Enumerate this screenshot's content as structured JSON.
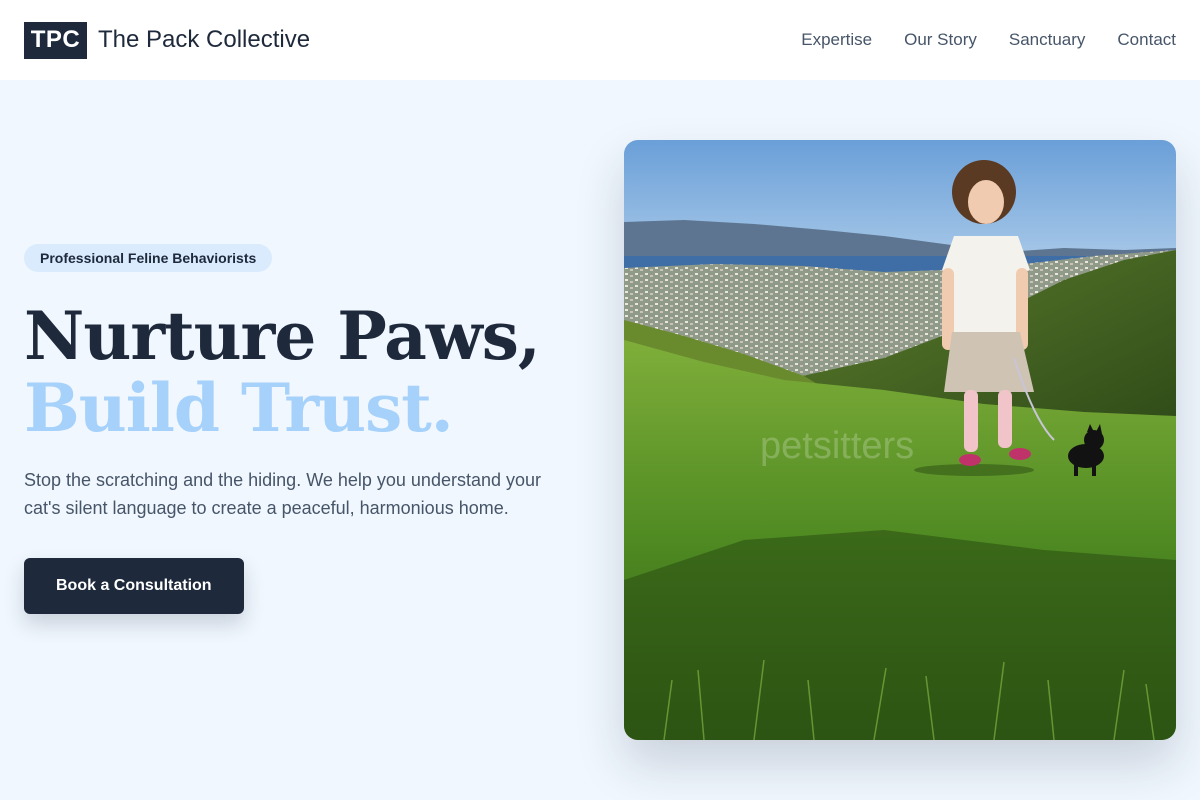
{
  "brand": {
    "mark": "TPC",
    "name": "The Pack Collective"
  },
  "nav": [
    {
      "label": "Expertise"
    },
    {
      "label": "Our Story"
    },
    {
      "label": "Sanctuary"
    },
    {
      "label": "Contact"
    }
  ],
  "hero": {
    "badge": "Professional Feline Behaviorists",
    "headline_line1": "Nurture Paws,",
    "headline_line2": "Build Trust.",
    "lede": "Stop the scratching and the hiding. We help you understand your cat's silent language to create a peaceful, harmonious home.",
    "cta_label": "Book a Consultation"
  },
  "photo": {
    "watermark": "petsitters"
  },
  "colors": {
    "navy": "#1e293b",
    "accent_light_blue": "#a6d1fb",
    "background": "#f0f7fe",
    "badge_bg": "#d9ebfd",
    "muted_text": "#475569"
  }
}
